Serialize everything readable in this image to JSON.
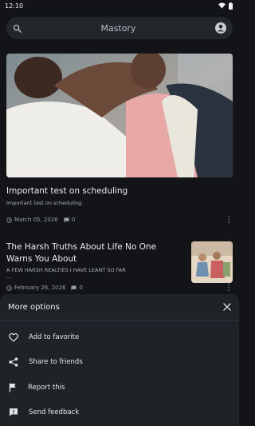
{
  "status_bar": {
    "time": "12:10"
  },
  "search": {
    "title": "Mastory"
  },
  "articles": [
    {
      "title": "Important test on scheduling",
      "subtitle": "Important test on scheduling.",
      "date": "March 05, 2026",
      "comments": "0"
    },
    {
      "title": "The Harsh Truths About Life No One Warns You About",
      "subtitle": "A FEW HARSH REALTIES I HAVE LEANT SO FAR",
      "subtitle_extra": "...",
      "date": "February 26, 2026",
      "comments": "0"
    }
  ],
  "sheet": {
    "title": "More options",
    "options": [
      {
        "label": "Add to favorite",
        "icon": "heart-icon"
      },
      {
        "label": "Share to friends",
        "icon": "share-icon"
      },
      {
        "label": "Report this",
        "icon": "flag-icon"
      },
      {
        "label": "Send feedback",
        "icon": "feedback-icon"
      }
    ]
  },
  "colors": {
    "background": "#121417",
    "sheet": "#1e2328",
    "search": "#23272c"
  }
}
